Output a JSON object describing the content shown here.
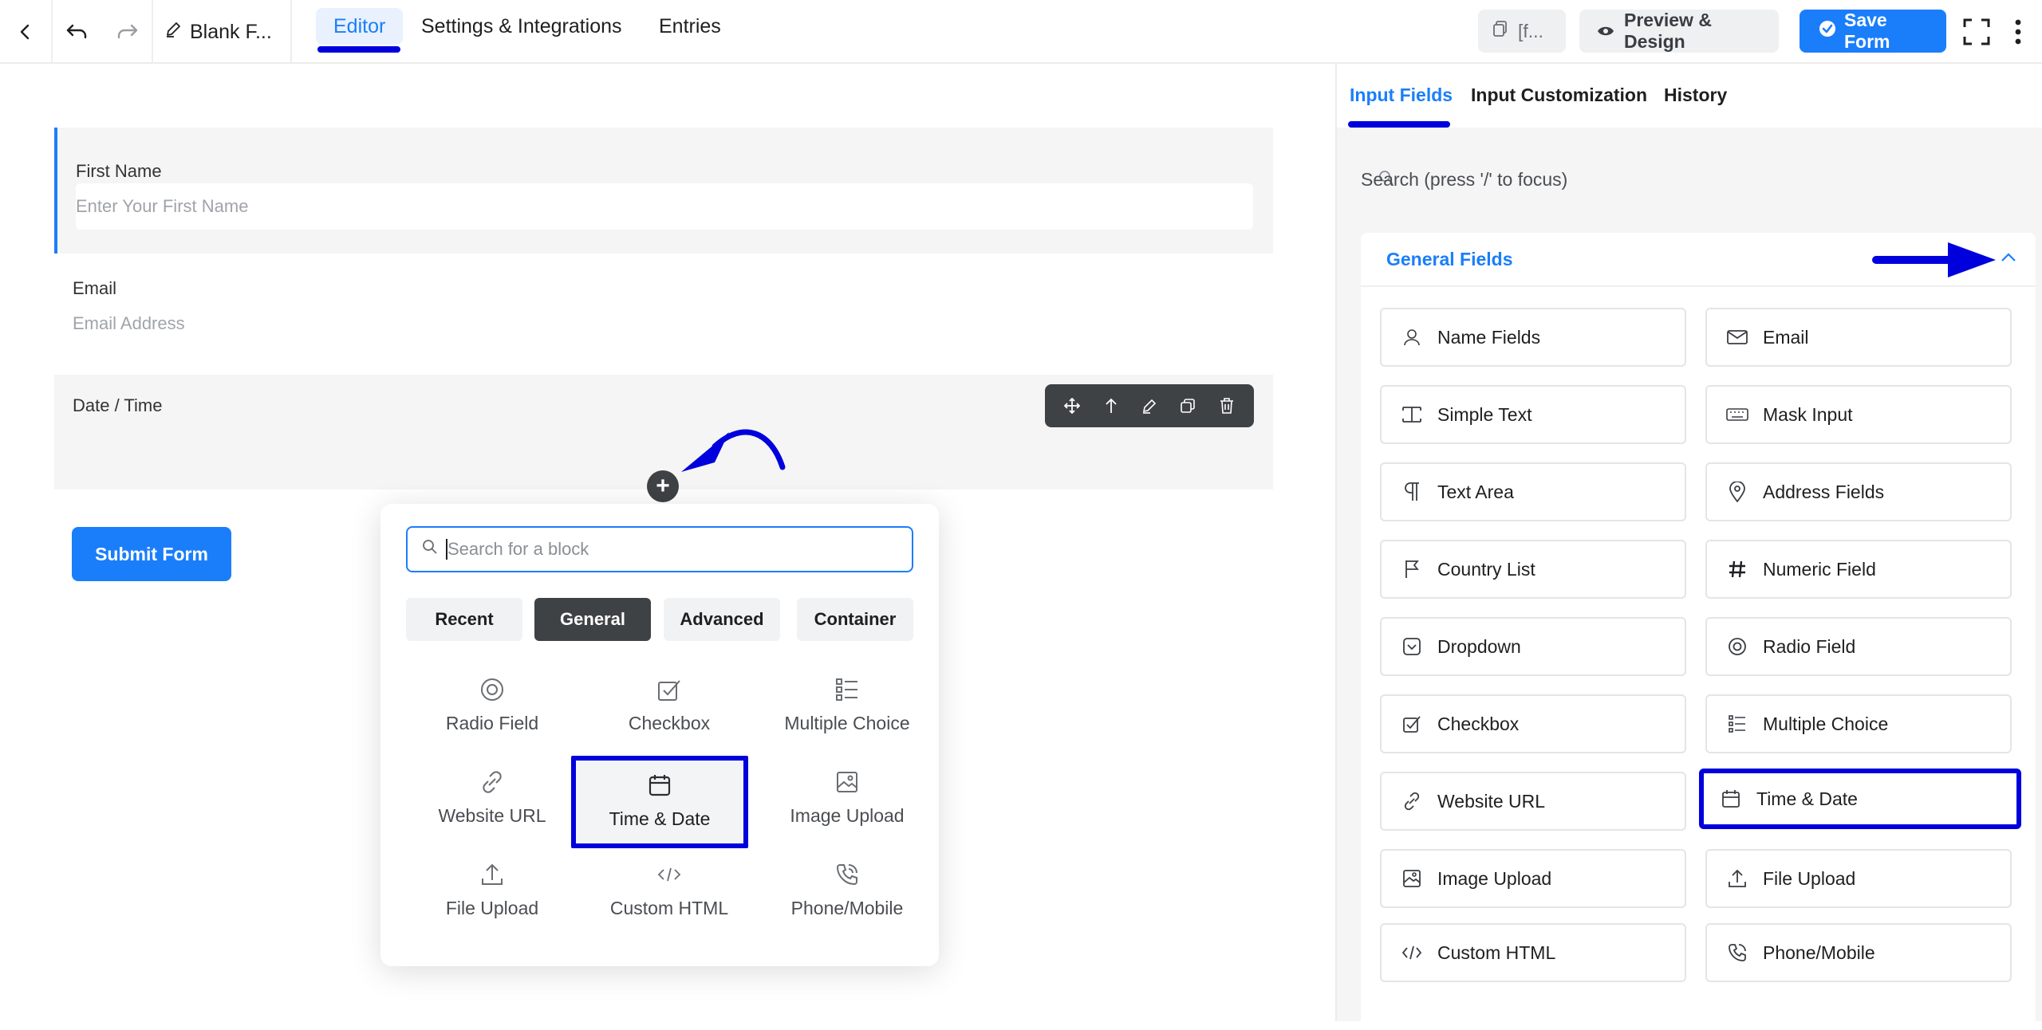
{
  "topbar": {
    "form_title": "Blank F...",
    "tabs": [
      {
        "label": "Editor"
      },
      {
        "label": "Settings & Integrations"
      },
      {
        "label": "Entries"
      }
    ],
    "shortcode_label": "[f...",
    "preview_label": "Preview & Design",
    "save_label": "Save Form"
  },
  "form": {
    "fields": [
      {
        "label": "First Name",
        "placeholder": "Enter Your First Name"
      },
      {
        "label": "Email",
        "placeholder": "Email Address"
      },
      {
        "label": "Date / Time"
      }
    ],
    "submit_label": "Submit Form"
  },
  "block_popup": {
    "search_placeholder": "Search for a block",
    "tabs": [
      "Recent",
      "General",
      "Advanced",
      "Container"
    ],
    "active_tab": "General",
    "items": [
      {
        "label": "Radio Field",
        "icon": "radio-icon"
      },
      {
        "label": "Checkbox",
        "icon": "checkbox-icon"
      },
      {
        "label": "Multiple Choice",
        "icon": "list-icon"
      },
      {
        "label": "Website URL",
        "icon": "link-icon"
      },
      {
        "label": "Time & Date",
        "icon": "calendar-icon",
        "selected": true
      },
      {
        "label": "Image Upload",
        "icon": "image-icon"
      },
      {
        "label": "File Upload",
        "icon": "upload-icon"
      },
      {
        "label": "Custom HTML",
        "icon": "code-icon"
      },
      {
        "label": "Phone/Mobile",
        "icon": "phone-icon"
      }
    ]
  },
  "right_panel": {
    "tabs": [
      {
        "label": "Input Fields"
      },
      {
        "label": "Input Customization"
      },
      {
        "label": "History"
      }
    ],
    "search_placeholder": "Search (press '/' to focus)",
    "section_title": "General Fields",
    "items": [
      {
        "label": "Name Fields",
        "icon": "user-icon"
      },
      {
        "label": "Email",
        "icon": "envelope-icon"
      },
      {
        "label": "Simple Text",
        "icon": "text-cursor-icon"
      },
      {
        "label": "Mask Input",
        "icon": "keyboard-icon"
      },
      {
        "label": "Text Area",
        "icon": "paragraph-icon"
      },
      {
        "label": "Address Fields",
        "icon": "map-pin-icon"
      },
      {
        "label": "Country List",
        "icon": "flag-icon"
      },
      {
        "label": "Numeric Field",
        "icon": "hash-icon"
      },
      {
        "label": "Dropdown",
        "icon": "dropdown-icon"
      },
      {
        "label": "Radio Field",
        "icon": "radio-icon"
      },
      {
        "label": "Checkbox",
        "icon": "checkbox-icon"
      },
      {
        "label": "Multiple Choice",
        "icon": "list-icon"
      },
      {
        "label": "Website URL",
        "icon": "link-icon"
      },
      {
        "label": "Time & Date",
        "icon": "calendar-icon",
        "selected": true
      },
      {
        "label": "Image Upload",
        "icon": "image-icon"
      },
      {
        "label": "File Upload",
        "icon": "upload-icon"
      },
      {
        "label": "Custom HTML",
        "icon": "code-icon"
      },
      {
        "label": "Phone/Mobile",
        "icon": "phone-icon"
      }
    ]
  },
  "colors": {
    "accent": "#1a7efb",
    "annotation": "#0000dd",
    "toolbar_dark": "#3f4245"
  }
}
